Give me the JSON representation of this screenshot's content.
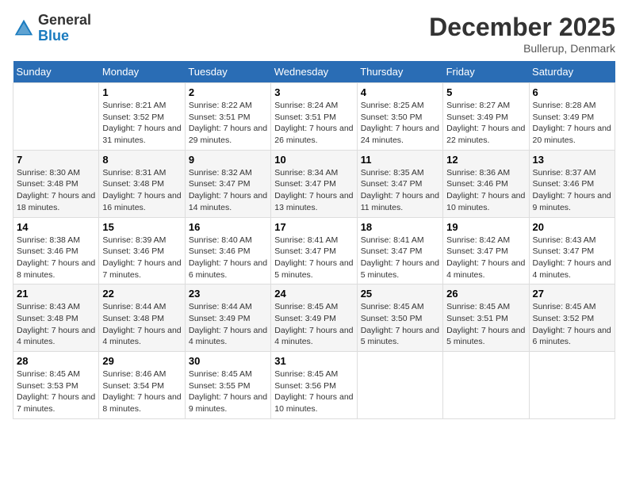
{
  "header": {
    "logo_general": "General",
    "logo_blue": "Blue",
    "month_title": "December 2025",
    "location": "Bullerup, Denmark"
  },
  "weekdays": [
    "Sunday",
    "Monday",
    "Tuesday",
    "Wednesday",
    "Thursday",
    "Friday",
    "Saturday"
  ],
  "weeks": [
    [
      {
        "day": "",
        "sunrise": "",
        "sunset": "",
        "daylight": ""
      },
      {
        "day": "1",
        "sunrise": "Sunrise: 8:21 AM",
        "sunset": "Sunset: 3:52 PM",
        "daylight": "Daylight: 7 hours and 31 minutes."
      },
      {
        "day": "2",
        "sunrise": "Sunrise: 8:22 AM",
        "sunset": "Sunset: 3:51 PM",
        "daylight": "Daylight: 7 hours and 29 minutes."
      },
      {
        "day": "3",
        "sunrise": "Sunrise: 8:24 AM",
        "sunset": "Sunset: 3:51 PM",
        "daylight": "Daylight: 7 hours and 26 minutes."
      },
      {
        "day": "4",
        "sunrise": "Sunrise: 8:25 AM",
        "sunset": "Sunset: 3:50 PM",
        "daylight": "Daylight: 7 hours and 24 minutes."
      },
      {
        "day": "5",
        "sunrise": "Sunrise: 8:27 AM",
        "sunset": "Sunset: 3:49 PM",
        "daylight": "Daylight: 7 hours and 22 minutes."
      },
      {
        "day": "6",
        "sunrise": "Sunrise: 8:28 AM",
        "sunset": "Sunset: 3:49 PM",
        "daylight": "Daylight: 7 hours and 20 minutes."
      }
    ],
    [
      {
        "day": "7",
        "sunrise": "Sunrise: 8:30 AM",
        "sunset": "Sunset: 3:48 PM",
        "daylight": "Daylight: 7 hours and 18 minutes."
      },
      {
        "day": "8",
        "sunrise": "Sunrise: 8:31 AM",
        "sunset": "Sunset: 3:48 PM",
        "daylight": "Daylight: 7 hours and 16 minutes."
      },
      {
        "day": "9",
        "sunrise": "Sunrise: 8:32 AM",
        "sunset": "Sunset: 3:47 PM",
        "daylight": "Daylight: 7 hours and 14 minutes."
      },
      {
        "day": "10",
        "sunrise": "Sunrise: 8:34 AM",
        "sunset": "Sunset: 3:47 PM",
        "daylight": "Daylight: 7 hours and 13 minutes."
      },
      {
        "day": "11",
        "sunrise": "Sunrise: 8:35 AM",
        "sunset": "Sunset: 3:47 PM",
        "daylight": "Daylight: 7 hours and 11 minutes."
      },
      {
        "day": "12",
        "sunrise": "Sunrise: 8:36 AM",
        "sunset": "Sunset: 3:46 PM",
        "daylight": "Daylight: 7 hours and 10 minutes."
      },
      {
        "day": "13",
        "sunrise": "Sunrise: 8:37 AM",
        "sunset": "Sunset: 3:46 PM",
        "daylight": "Daylight: 7 hours and 9 minutes."
      }
    ],
    [
      {
        "day": "14",
        "sunrise": "Sunrise: 8:38 AM",
        "sunset": "Sunset: 3:46 PM",
        "daylight": "Daylight: 7 hours and 8 minutes."
      },
      {
        "day": "15",
        "sunrise": "Sunrise: 8:39 AM",
        "sunset": "Sunset: 3:46 PM",
        "daylight": "Daylight: 7 hours and 7 minutes."
      },
      {
        "day": "16",
        "sunrise": "Sunrise: 8:40 AM",
        "sunset": "Sunset: 3:46 PM",
        "daylight": "Daylight: 7 hours and 6 minutes."
      },
      {
        "day": "17",
        "sunrise": "Sunrise: 8:41 AM",
        "sunset": "Sunset: 3:47 PM",
        "daylight": "Daylight: 7 hours and 5 minutes."
      },
      {
        "day": "18",
        "sunrise": "Sunrise: 8:41 AM",
        "sunset": "Sunset: 3:47 PM",
        "daylight": "Daylight: 7 hours and 5 minutes."
      },
      {
        "day": "19",
        "sunrise": "Sunrise: 8:42 AM",
        "sunset": "Sunset: 3:47 PM",
        "daylight": "Daylight: 7 hours and 4 minutes."
      },
      {
        "day": "20",
        "sunrise": "Sunrise: 8:43 AM",
        "sunset": "Sunset: 3:47 PM",
        "daylight": "Daylight: 7 hours and 4 minutes."
      }
    ],
    [
      {
        "day": "21",
        "sunrise": "Sunrise: 8:43 AM",
        "sunset": "Sunset: 3:48 PM",
        "daylight": "Daylight: 7 hours and 4 minutes."
      },
      {
        "day": "22",
        "sunrise": "Sunrise: 8:44 AM",
        "sunset": "Sunset: 3:48 PM",
        "daylight": "Daylight: 7 hours and 4 minutes."
      },
      {
        "day": "23",
        "sunrise": "Sunrise: 8:44 AM",
        "sunset": "Sunset: 3:49 PM",
        "daylight": "Daylight: 7 hours and 4 minutes."
      },
      {
        "day": "24",
        "sunrise": "Sunrise: 8:45 AM",
        "sunset": "Sunset: 3:49 PM",
        "daylight": "Daylight: 7 hours and 4 minutes."
      },
      {
        "day": "25",
        "sunrise": "Sunrise: 8:45 AM",
        "sunset": "Sunset: 3:50 PM",
        "daylight": "Daylight: 7 hours and 5 minutes."
      },
      {
        "day": "26",
        "sunrise": "Sunrise: 8:45 AM",
        "sunset": "Sunset: 3:51 PM",
        "daylight": "Daylight: 7 hours and 5 minutes."
      },
      {
        "day": "27",
        "sunrise": "Sunrise: 8:45 AM",
        "sunset": "Sunset: 3:52 PM",
        "daylight": "Daylight: 7 hours and 6 minutes."
      }
    ],
    [
      {
        "day": "28",
        "sunrise": "Sunrise: 8:45 AM",
        "sunset": "Sunset: 3:53 PM",
        "daylight": "Daylight: 7 hours and 7 minutes."
      },
      {
        "day": "29",
        "sunrise": "Sunrise: 8:46 AM",
        "sunset": "Sunset: 3:54 PM",
        "daylight": "Daylight: 7 hours and 8 minutes."
      },
      {
        "day": "30",
        "sunrise": "Sunrise: 8:45 AM",
        "sunset": "Sunset: 3:55 PM",
        "daylight": "Daylight: 7 hours and 9 minutes."
      },
      {
        "day": "31",
        "sunrise": "Sunrise: 8:45 AM",
        "sunset": "Sunset: 3:56 PM",
        "daylight": "Daylight: 7 hours and 10 minutes."
      },
      {
        "day": "",
        "sunrise": "",
        "sunset": "",
        "daylight": ""
      },
      {
        "day": "",
        "sunrise": "",
        "sunset": "",
        "daylight": ""
      },
      {
        "day": "",
        "sunrise": "",
        "sunset": "",
        "daylight": ""
      }
    ]
  ]
}
